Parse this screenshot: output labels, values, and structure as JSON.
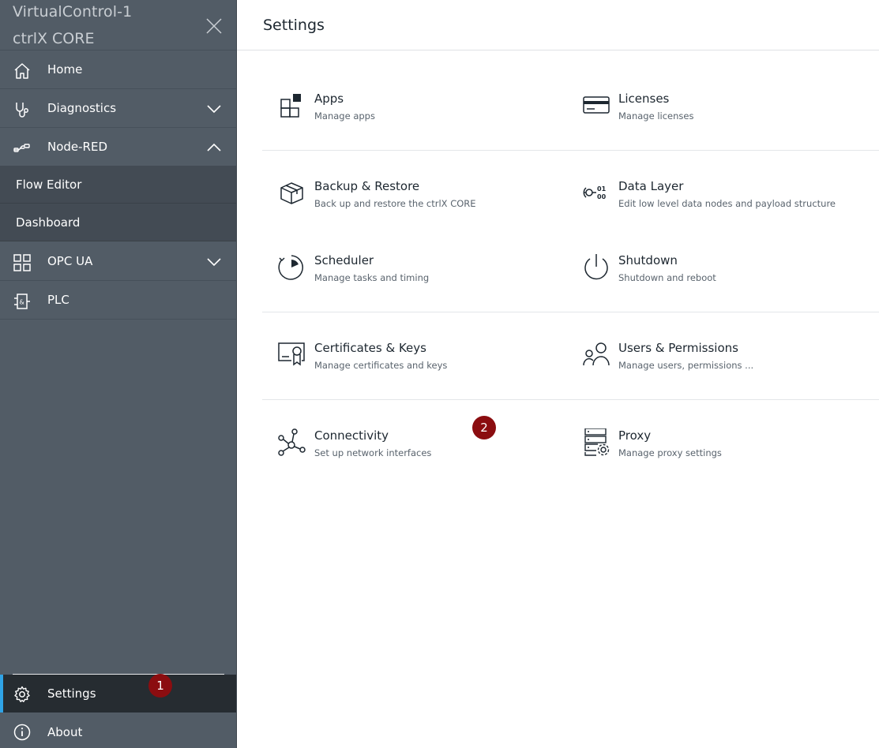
{
  "sidebar": {
    "brand_line1": "VirtualControl-1",
    "brand_line2": "ctrlX CORE",
    "close_icon": "close-icon",
    "items": [
      {
        "label": "Home",
        "icon": "home-icon"
      },
      {
        "label": "Diagnostics",
        "icon": "stethoscope-icon",
        "expanded": false
      },
      {
        "label": "Node-RED",
        "icon": "node-red-icon",
        "expanded": true
      },
      {
        "label": "OPC UA",
        "icon": "grid-icon",
        "expanded": false
      },
      {
        "label": "PLC",
        "icon": "plc-icon"
      }
    ],
    "node_red_sub": [
      {
        "label": "Flow Editor"
      },
      {
        "label": "Dashboard"
      }
    ],
    "settings": {
      "label": "Settings",
      "icon": "gear-icon",
      "active": true
    },
    "about": {
      "label": "About",
      "icon": "info-icon"
    }
  },
  "header": {
    "title": "Settings"
  },
  "badges": {
    "one": "1",
    "two": "2"
  },
  "colors": {
    "sidebar": "#525c66",
    "active_item": "#262c31",
    "accent": "#2fa3e6",
    "badge": "#8b0d10"
  },
  "cards": [
    {
      "title": "Apps",
      "subtitle": "Manage apps",
      "icon": "apps-icon"
    },
    {
      "title": "Licenses",
      "subtitle": "Manage licenses",
      "icon": "license-card-icon"
    },
    {
      "title": "Backup & Restore",
      "subtitle": "Back up and restore the ctrlX CORE",
      "icon": "box-icon"
    },
    {
      "title": "Data Layer",
      "subtitle": "Edit low level data nodes and payload structure",
      "icon": "data-layer-icon"
    },
    {
      "title": "Scheduler",
      "subtitle": "Manage tasks and timing",
      "icon": "scheduler-icon"
    },
    {
      "title": "Shutdown",
      "subtitle": "Shutdown and reboot",
      "icon": "power-icon"
    },
    {
      "title": "Certificates & Keys",
      "subtitle": "Manage certificates and keys",
      "icon": "certificate-icon"
    },
    {
      "title": "Users & Permissions",
      "subtitle": "Manage users, permissions ...",
      "icon": "users-icon"
    },
    {
      "title": "Connectivity",
      "subtitle": "Set up network interfaces",
      "icon": "network-icon"
    },
    {
      "title": "Proxy",
      "subtitle": "Manage proxy settings",
      "icon": "proxy-icon"
    }
  ]
}
